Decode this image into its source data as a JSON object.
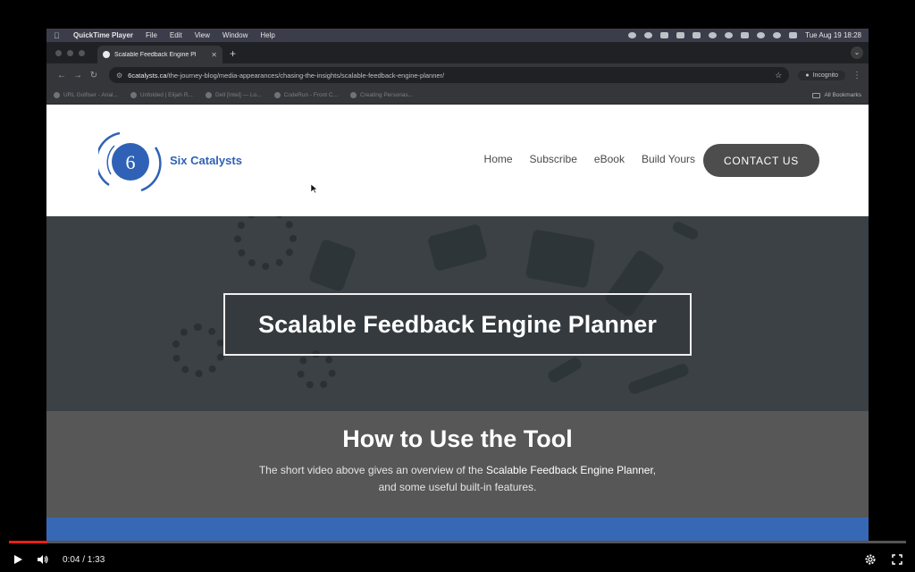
{
  "menubar": {
    "app": "QuickTime Player",
    "items": [
      "File",
      "Edit",
      "View",
      "Window",
      "Help"
    ],
    "clock": "Tue Aug 19  18:28"
  },
  "browser": {
    "tab_title": "Scalable Feedback Engine Pl",
    "url_domain": "6catalysts.ca",
    "url_path": "/the-journey-blog/media-appearances/chasing-the-insights/scalable-feedback-engine-planner/",
    "incognito_label": "Incognito",
    "bookmarks": [
      "URL Golfiser - Anal...",
      "Unfolded | Elijah R...",
      "Dell [Intel] — Lo...",
      "CodeRun - Front C...",
      "Creating Personas..."
    ],
    "all_bookmarks": "All Bookmarks"
  },
  "site": {
    "logo_digit": "6",
    "brand": "Six Catalysts",
    "nav": [
      "Home",
      "Subscribe",
      "eBook",
      "Build Yours"
    ],
    "contact_label": "CONTACT US",
    "hero_title": "Scalable Feedback Engine Planner",
    "howto_title": "How to Use the Tool",
    "howto_text_before": "The short video above gives an overview of the ",
    "howto_text_bold": "Scalable Feedback Engine Planner",
    "howto_text_after": ",",
    "howto_text_line2": "and some useful built-in features."
  },
  "player": {
    "time_current": "0:04",
    "time_total": "1:33",
    "time_display": "0:04 / 1:33",
    "progress_fraction": 0.043,
    "accent": "#e62117"
  },
  "colors": {
    "brand_blue": "#2f62b6",
    "contact_bg": "#4d4d4d",
    "howto_bg": "#575757",
    "bottom_bar": "#3668b6"
  }
}
